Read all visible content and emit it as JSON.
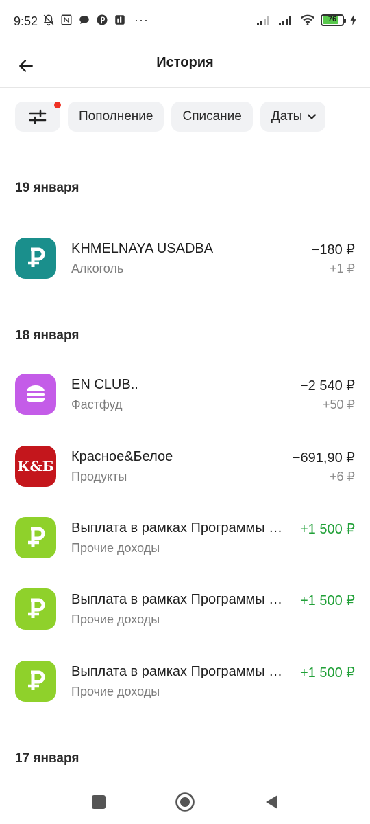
{
  "status_bar": {
    "time": "9:52",
    "battery_level": "76",
    "battery_fraction": 0.76,
    "dots": "···",
    "icons_left": [
      "mute-bell-icon",
      "nfc-icon",
      "chat-bubble-icon",
      "pinterest-icon",
      "app-icon"
    ],
    "icons_right": [
      "signal-icon",
      "signal-icon",
      "wifi-icon",
      "battery-icon",
      "charging-icon"
    ]
  },
  "header": {
    "title": "История",
    "back_icon": "arrow-left-icon"
  },
  "filters": {
    "filter_icon": "sliders-icon",
    "has_active_filter": true,
    "chips": [
      "Пополнение",
      "Списание"
    ],
    "dates_label": "Даты",
    "dates_icon": "chevron-down-icon"
  },
  "groups": [
    {
      "date": "19 января",
      "transactions": [
        {
          "name": "KHMELNAYA USADBA",
          "category": "Алкоголь",
          "amount": "−180 ₽",
          "bonus": "+1 ₽",
          "icon": "ruble-icon",
          "color": "#1a8f8c",
          "income": false
        }
      ]
    },
    {
      "date": "18 января",
      "transactions": [
        {
          "name": "EN CLUB..",
          "category": "Фастфуд",
          "amount": "−2 540 ₽",
          "bonus": "+50 ₽",
          "icon": "burger-icon",
          "color": "#c45ce8",
          "income": false
        },
        {
          "name": "Красное&Белое",
          "category": "Продукты",
          "amount": "−691,90 ₽",
          "bonus": "+6 ₽",
          "icon": "kb-logo",
          "logo_text": "К&Б",
          "color": "#c4161c",
          "income": false
        },
        {
          "name": "Выплата в рамках Программы лояльности",
          "category": "Прочие доходы",
          "amount": "+1 500 ₽",
          "bonus": "",
          "icon": "ruble-icon",
          "color": "#8fd12b",
          "income": true
        },
        {
          "name": "Выплата в рамках Программы лояльности",
          "category": "Прочие доходы",
          "amount": "+1 500 ₽",
          "bonus": "",
          "icon": "ruble-icon",
          "color": "#8fd12b",
          "income": true
        },
        {
          "name": "Выплата в рамках Программы лояльности",
          "category": "Прочие доходы",
          "amount": "+1 500 ₽",
          "bonus": "",
          "icon": "ruble-icon",
          "color": "#8fd12b",
          "income": true
        }
      ]
    },
    {
      "date": "17 января",
      "transactions": []
    }
  ],
  "colors": {
    "income": "#21a038",
    "accent_dot": "#ef3124",
    "chip_bg": "#f1f2f4"
  },
  "navbar": {
    "icons": [
      "recents-square-icon",
      "home-circle-icon",
      "back-triangle-icon"
    ]
  }
}
